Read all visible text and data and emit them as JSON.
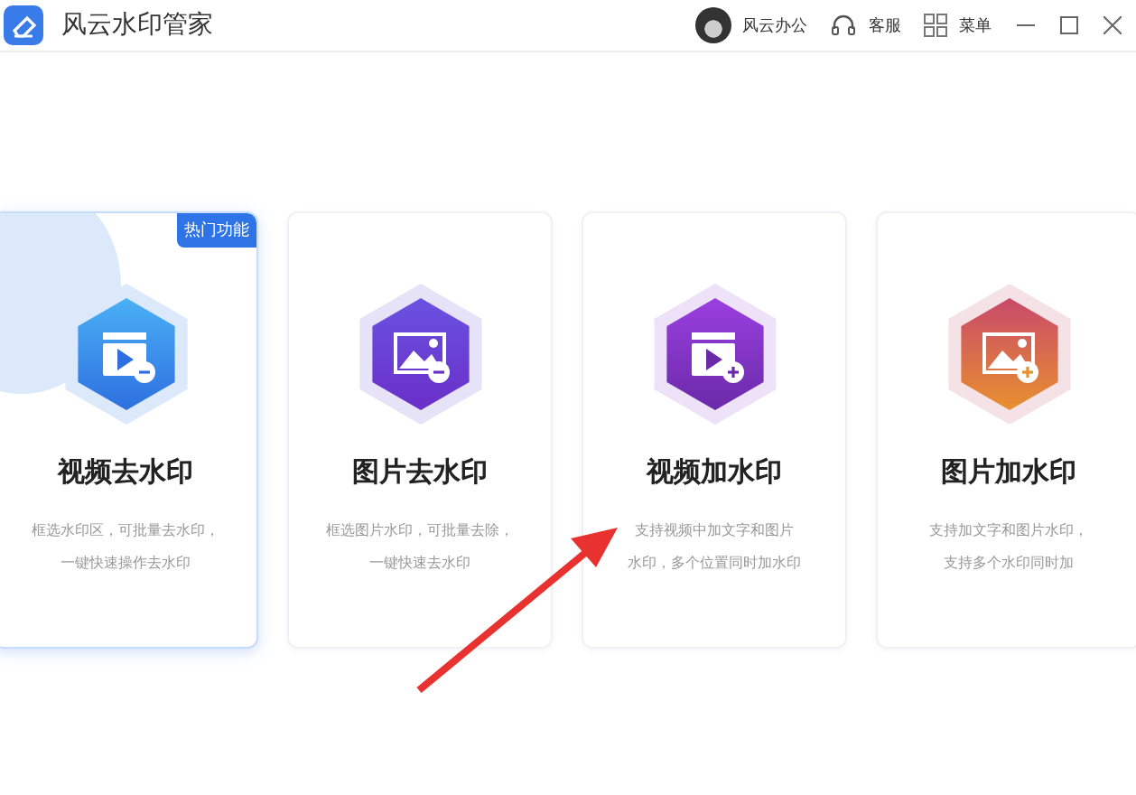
{
  "window": {
    "title": "风云水印管家",
    "user": "风云办公",
    "support": "客服",
    "menu": "菜单"
  },
  "cards": [
    {
      "kind": "video-remove",
      "title": "视频去水印",
      "lines": [
        "框选水印区，可批量去水印，",
        "一键快速操作去水印"
      ],
      "badge": "热门功能",
      "selected": true
    },
    {
      "kind": "image-remove",
      "title": "图片去水印",
      "lines": [
        "框选图片水印，可批量去除，",
        "一键快速去水印"
      ],
      "selected": false
    },
    {
      "kind": "video-add",
      "title": "视频加水印",
      "lines": [
        "支持视频中加文字和图片",
        "水印，多个位置同时加水印"
      ],
      "selected": false
    },
    {
      "kind": "image-add",
      "title": "图片加水印",
      "lines": [
        "支持加文字和图片水印，",
        "支持多个水印同时加"
      ],
      "selected": false
    }
  ]
}
